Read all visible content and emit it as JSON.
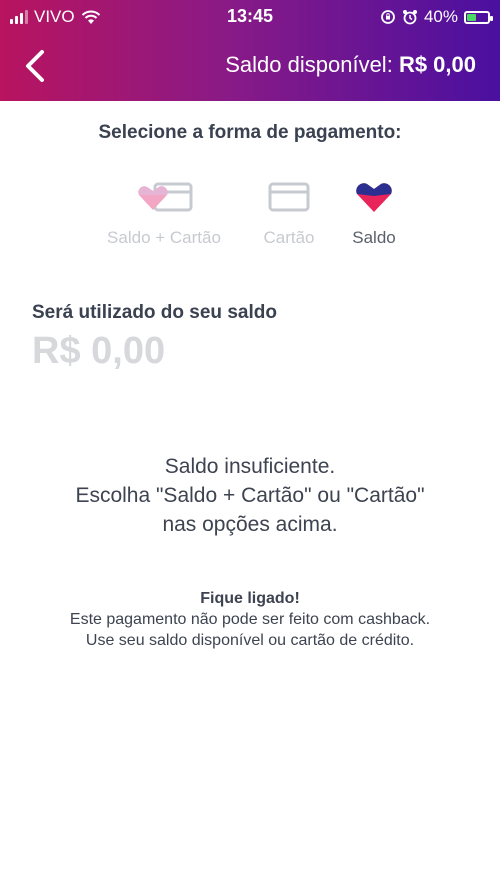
{
  "status_bar": {
    "carrier": "VIVO",
    "time": "13:45",
    "battery_percent": "40%",
    "battery_level": 0.4,
    "icons": [
      "signal-icon",
      "wifi-icon",
      "rotation-lock-icon",
      "alarm-icon",
      "battery-charging-icon"
    ]
  },
  "header": {
    "back_icon": "chevron-left-icon",
    "balance_label": "Saldo disponível:",
    "balance_value": "R$ 0,00",
    "gradient_colors": [
      "#b8145f",
      "#8a1a86",
      "#4a10a0"
    ]
  },
  "payment": {
    "title": "Selecione a forma de pagamento:",
    "options": [
      {
        "label": "Saldo + Cartão",
        "icon": "heart-card-icon",
        "selected": false
      },
      {
        "label": "Cartão",
        "icon": "card-icon",
        "selected": false
      },
      {
        "label": "Saldo",
        "icon": "heart-icon",
        "selected": true
      }
    ]
  },
  "balance_usage": {
    "label": "Será utilizado do seu saldo",
    "value": "R$ 0,00"
  },
  "insufficient": {
    "line1": "Saldo insuficiente.",
    "line2": "Escolha \"Saldo + Cartão\" ou \"Cartão\"",
    "line3": "nas opções acima."
  },
  "notice": {
    "title": "Fique ligado!",
    "line1": "Este pagamento não pode ser feito com cashback.",
    "line2": "Use seu saldo disponível ou cartão de crédito."
  },
  "colors": {
    "heart_top": "#2b2f8f",
    "heart_bottom": "#e8245a",
    "inactive": "#c7cad0"
  }
}
